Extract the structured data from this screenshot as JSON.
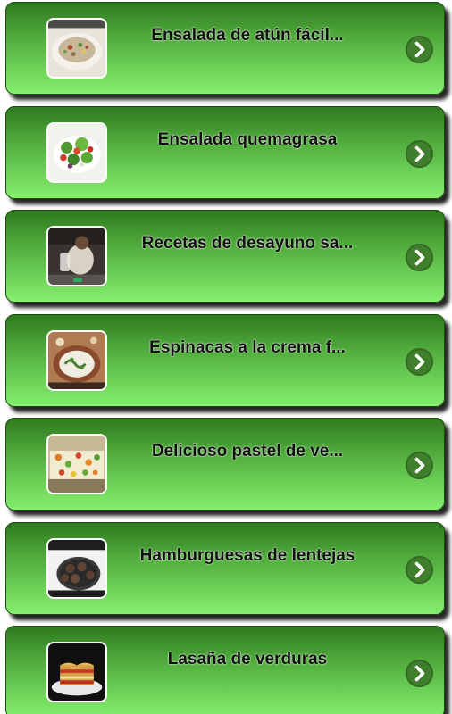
{
  "recipes": [
    {
      "title": "Ensalada de atún fácil...",
      "thumb_icon": "tuna-salad-photo",
      "arrow_icon": "chevron-right-icon"
    },
    {
      "title": "Ensalada quemagrasa",
      "thumb_icon": "fat-burning-salad-photo",
      "arrow_icon": "chevron-right-icon"
    },
    {
      "title": "Recetas de desayuno sa...",
      "thumb_icon": "breakfast-photo",
      "arrow_icon": "chevron-right-icon"
    },
    {
      "title": "Espinacas a la crema f...",
      "thumb_icon": "creamed-spinach-photo",
      "arrow_icon": "chevron-right-icon"
    },
    {
      "title": "Delicioso pastel de ve...",
      "thumb_icon": "vegetable-cake-photo",
      "arrow_icon": "chevron-right-icon"
    },
    {
      "title": "Hamburguesas de lentejas",
      "thumb_icon": "lentil-burgers-photo",
      "arrow_icon": "chevron-right-icon"
    },
    {
      "title": "Lasaña de verduras",
      "thumb_icon": "vegetable-lasagna-photo",
      "arrow_icon": "chevron-right-icon"
    }
  ],
  "colors": {
    "card_top": "#2f7a1f",
    "card_bottom": "#86ee6e",
    "arrow_bg": "#3f7f2c"
  }
}
